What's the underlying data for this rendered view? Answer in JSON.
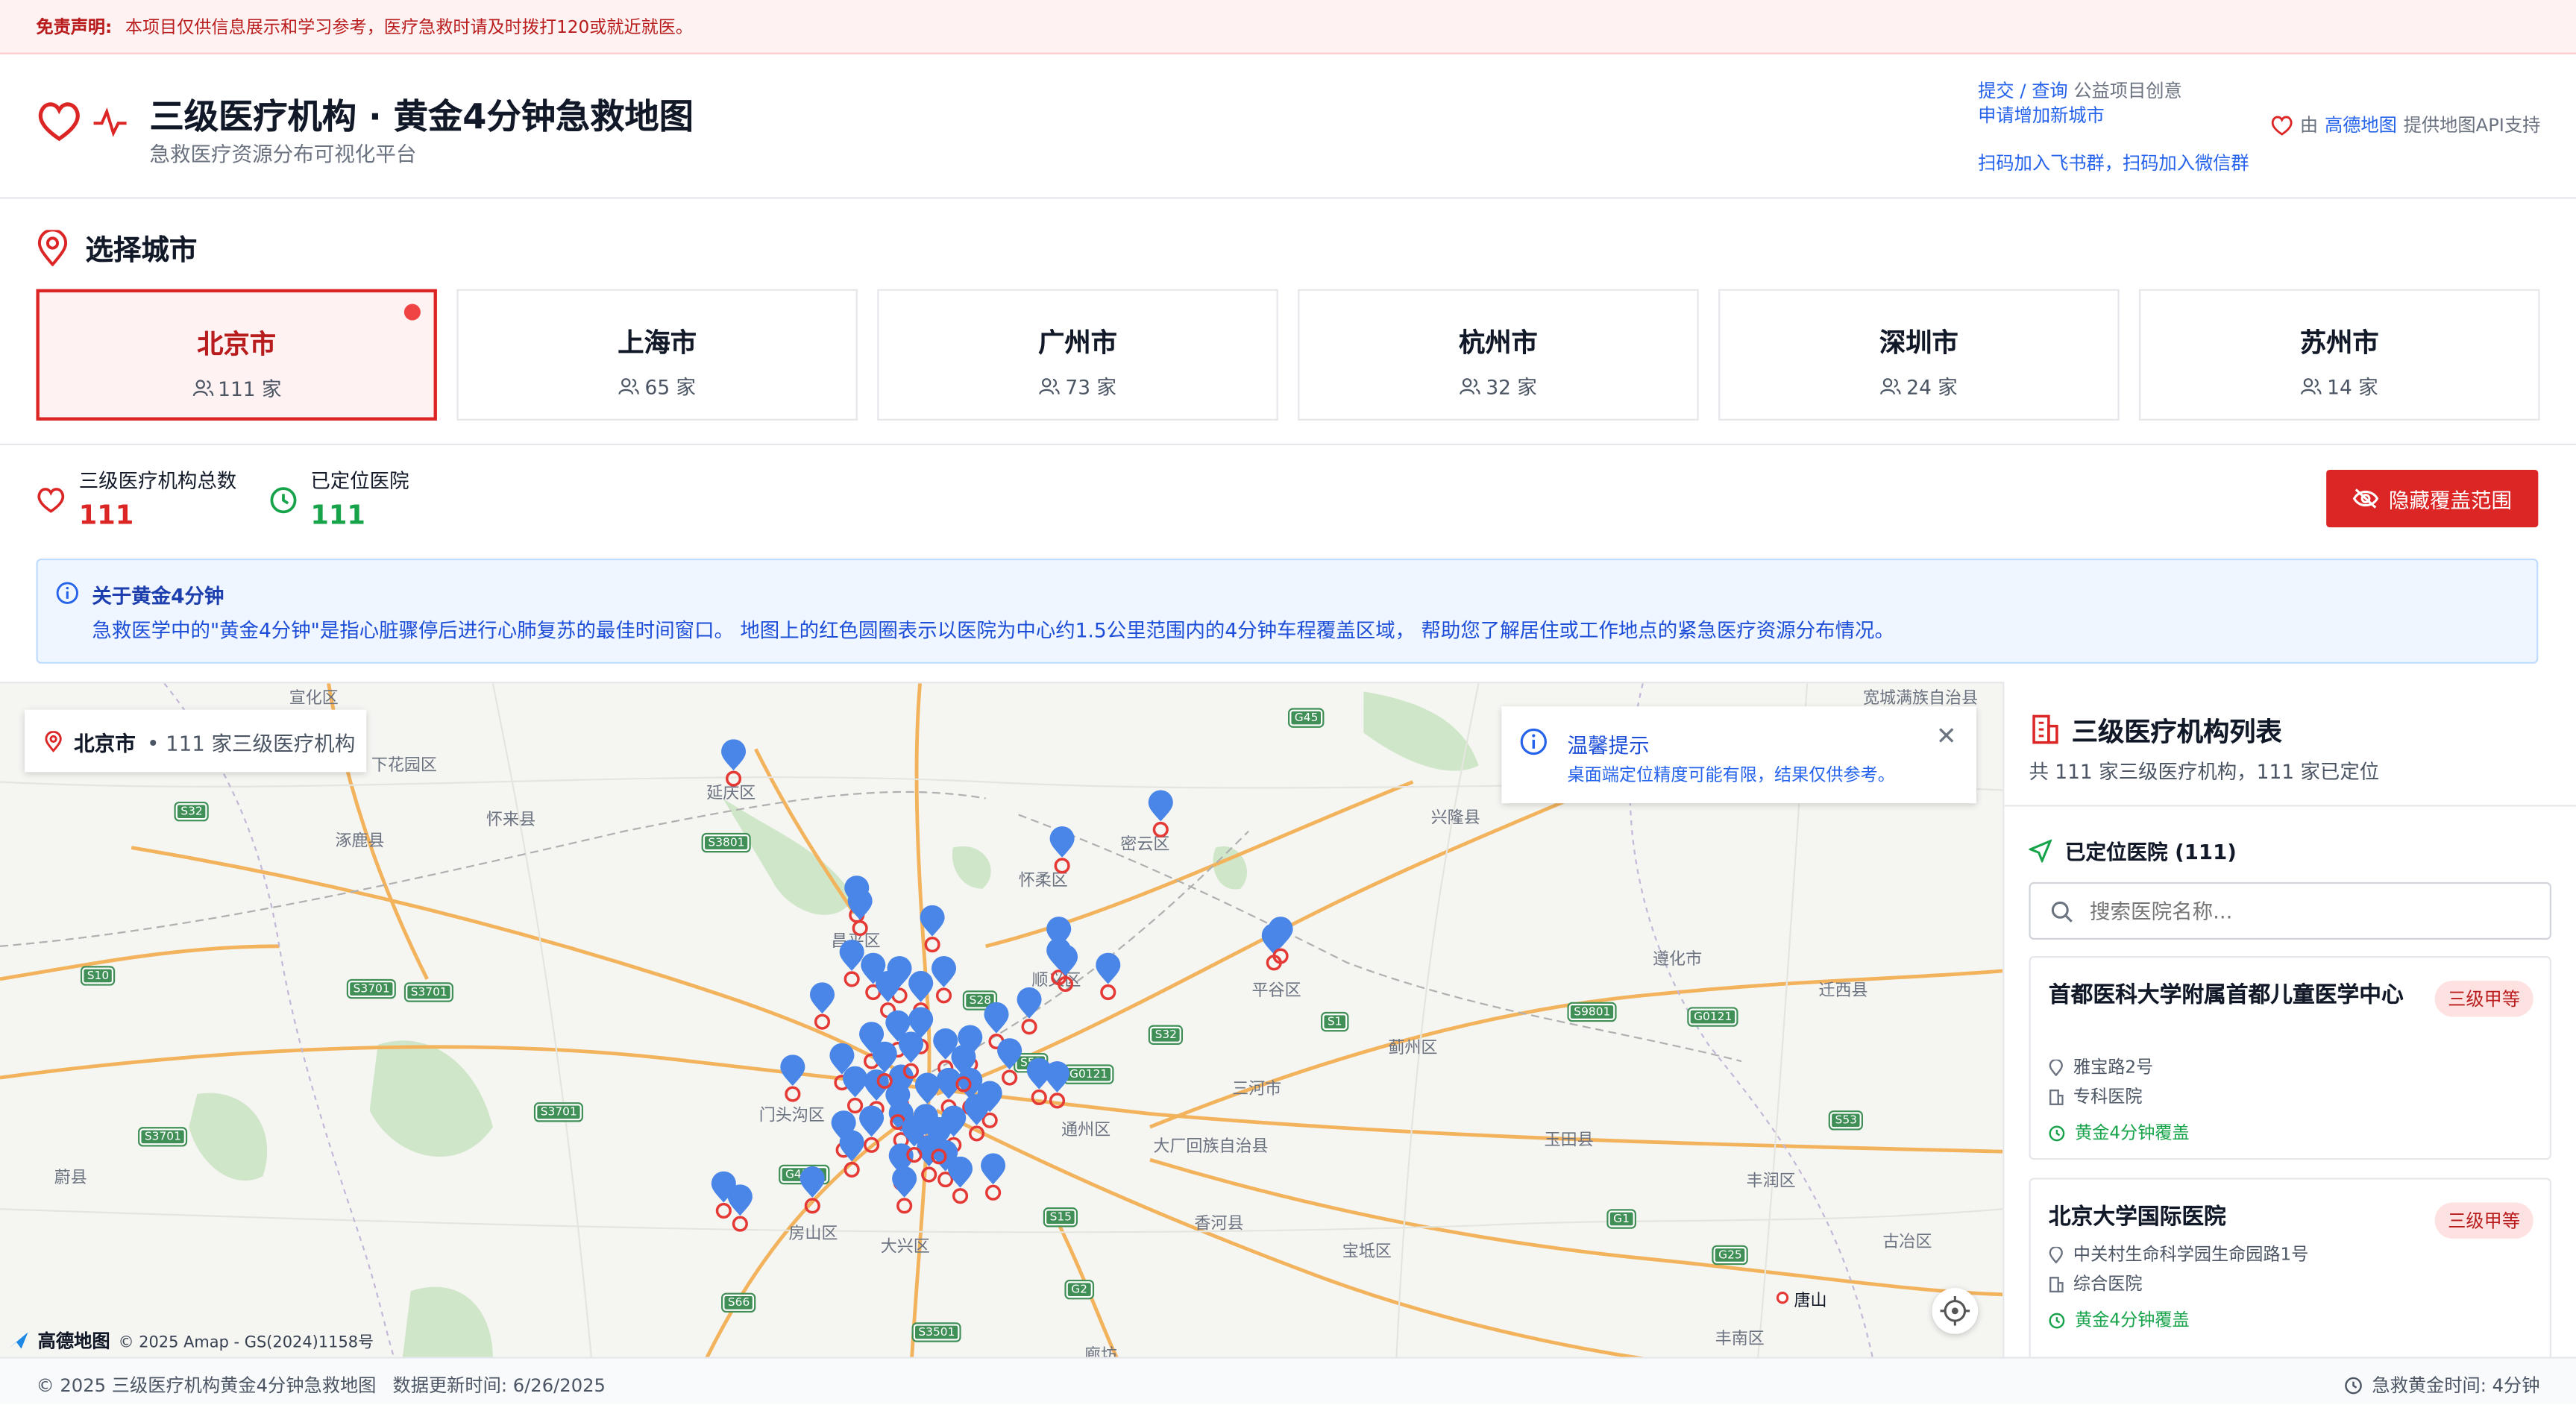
{
  "disclaimer": {
    "label": "免责声明:",
    "text": "本项目仅供信息展示和学习参考，医疗急救时请及时拨打120或就近就医。"
  },
  "header": {
    "title": "三级医疗机构 · 黄金4分钟急救地图",
    "subtitle": "急救医疗资源分布可视化平台",
    "link_submit": "提交 / 查询",
    "link_submit_suffix": "公益项目创意",
    "link_add_city": "申请增加新城市",
    "link_groups": "扫码加入飞书群，扫码加入微信群",
    "credit_prefix": "由",
    "credit_link": "高德地图",
    "credit_suffix": "提供地图API支持"
  },
  "city_section": {
    "title": "选择城市"
  },
  "cities": [
    {
      "name": "北京市",
      "count": "111 家",
      "selected": true
    },
    {
      "name": "上海市",
      "count": "65 家"
    },
    {
      "name": "广州市",
      "count": "73 家"
    },
    {
      "name": "杭州市",
      "count": "32 家"
    },
    {
      "name": "深圳市",
      "count": "24 家"
    },
    {
      "name": "苏州市",
      "count": "14 家"
    }
  ],
  "stats": {
    "total_label": "三级医疗机构总数",
    "total_value": "111",
    "located_label": "已定位医院",
    "located_value": "111"
  },
  "hide_button": "隐藏覆盖范围",
  "about": {
    "title": "关于黄金4分钟",
    "text": "急救医学中的\"黄金4分钟\"是指心脏骤停后进行心肺复苏的最佳时间窗口。 地图上的红色圆圈表示以医院为中心约1.5公里范围内的4分钟车程覆盖区域， 帮助您了解居住或工作地点的紧急医疗资源分布情况。"
  },
  "map": {
    "city_chip": {
      "city": "北京市",
      "count": "• 111 家三级医疗机构"
    },
    "tip": {
      "title": "温馨提示",
      "text": "桌面端定位精度可能有限，结果仅供参考。"
    },
    "attribution": {
      "logo": "高德地图",
      "copyright": "© 2025 Amap - GS(2024)1158号"
    },
    "places": [
      "宣化区",
      "宽城满族自治县",
      "下花园区",
      "怀来县",
      "涿鹿县",
      "延庆区",
      "密云区",
      "怀柔区",
      "昌平区",
      "兴隆县",
      "顺义区",
      "平谷区",
      "遵化市",
      "迁西县",
      "蓟州区",
      "三河市",
      "门头沟区",
      "通州区",
      "大厂回族自治县",
      "玉田县",
      "丰润区",
      "房山区",
      "大兴区",
      "香河县",
      "宝坻区",
      "古冶区",
      "唐山",
      "丰南区",
      "蔚县",
      "廊坊"
    ],
    "roads": [
      "G45",
      "S32",
      "S3801",
      "S10",
      "S3701",
      "S3701",
      "S28",
      "S9801",
      "G0121",
      "S1",
      "S32",
      "G0121",
      "S51",
      "S3701",
      "G4501",
      "S15",
      "G1",
      "S53",
      "S3701",
      "S66",
      "G2",
      "S3501",
      "G25"
    ]
  },
  "sidebar": {
    "title": "三级医疗机构列表",
    "summary": "共 111 家三级医疗机构，111 家已定位",
    "located_header": "已定位医院 (111)",
    "search_placeholder": "搜索医院名称...",
    "hospitals": [
      {
        "name": "首都医科大学附属首都儿童医学中心",
        "tag": "三级甲等",
        "address": "雅宝路2号",
        "type": "专科医院",
        "coverage": "黄金4分钟覆盖"
      },
      {
        "name": "北京大学国际医院",
        "tag": "三级甲等",
        "address": "中关村生命科学园生命园路1号",
        "type": "综合医院",
        "coverage": "黄金4分钟覆盖"
      }
    ]
  },
  "footer": {
    "copyright": "© 2025 三级医疗机构黄金4分钟急救地图",
    "updated": "数据更新时间: 6/26/2025",
    "golden": "急救黄金时间: 4分钟"
  },
  "colors": {
    "primary": "#dc2626",
    "pin": "#4a86e8",
    "accent_blue": "#2563eb",
    "green": "#16a34a"
  }
}
